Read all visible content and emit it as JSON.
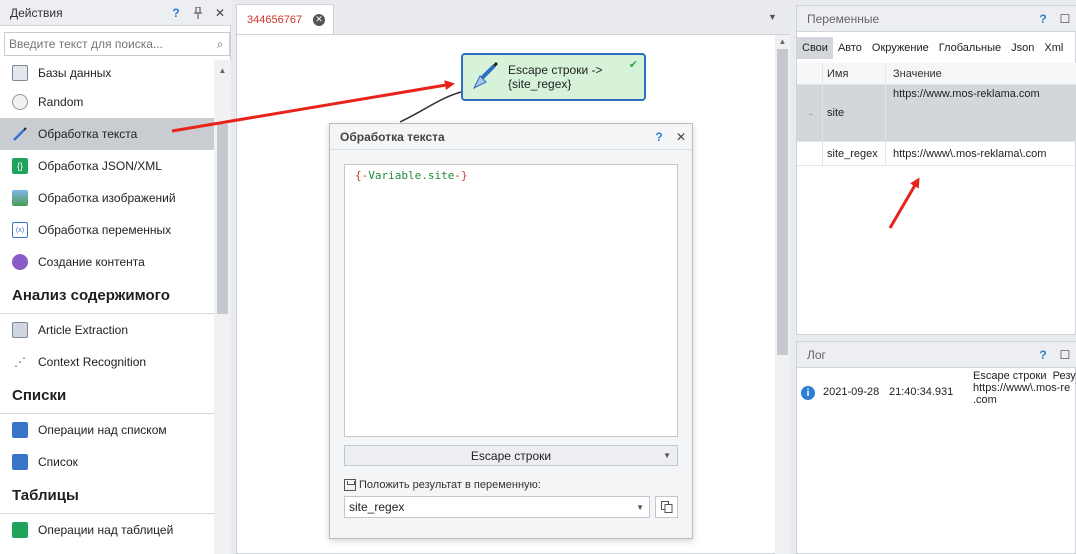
{
  "left_panel": {
    "title": "Действия",
    "search_placeholder": "Введите текст для поиска...",
    "items": [
      {
        "label": "Базы данных",
        "icon": "database-icon"
      },
      {
        "label": "Random",
        "icon": "dice-icon"
      },
      {
        "label": "Обработка текста",
        "icon": "pen-icon"
      },
      {
        "label": "Обработка JSON/XML",
        "icon": "json-icon"
      },
      {
        "label": "Обработка изображений",
        "icon": "image-icon"
      },
      {
        "label": "Обработка переменных",
        "icon": "variable-icon"
      },
      {
        "label": "Создание контента",
        "icon": "content-icon"
      }
    ],
    "section_analysis": "Анализ содержимого",
    "analysis_items": [
      {
        "label": "Article Extraction",
        "icon": "article-icon"
      },
      {
        "label": "Context Recognition",
        "icon": "context-icon"
      }
    ],
    "section_lists": "Списки",
    "list_items": [
      {
        "label": "Операции над списком",
        "icon": "list-ops-icon"
      },
      {
        "label": "Список",
        "icon": "list-icon"
      }
    ],
    "section_tables": "Таблицы",
    "table_items": [
      {
        "label": "Операции над таблицей",
        "icon": "table-ops-icon"
      }
    ]
  },
  "tab": {
    "label": "344656767"
  },
  "node": {
    "line1": "Escape строки ->",
    "line2": "{site_regex}"
  },
  "dialog": {
    "title": "Обработка текста",
    "editor": {
      "open": "{-",
      "name": "Variable.site",
      "close": "-}"
    },
    "mode": "Escape строки",
    "save_label": "Положить результат в переменную:",
    "variable": "site_regex"
  },
  "variables_panel": {
    "title": "Переменные",
    "tabs": [
      "Свои",
      "Авто",
      "Окружение",
      "Глобальные",
      "Json",
      "Xml"
    ],
    "col_name": "Имя",
    "col_value": "Значение",
    "rows": [
      {
        "name": "site",
        "value": "https://www.mos-reklama.com"
      },
      {
        "name": "site_regex",
        "value": "https://www\\.mos-reklama\\.com"
      }
    ]
  },
  "log_panel": {
    "title": "Лог",
    "entry": {
      "date": "2021-09-28",
      "time": "21:40:34.931",
      "message": "Escape строки  Резу\nhttps://www\\.mos-re\n.com"
    }
  },
  "colors": {
    "accent": "#2d7fd3",
    "node_fill": "#d6f2d8",
    "arrow": "#e8231c"
  }
}
